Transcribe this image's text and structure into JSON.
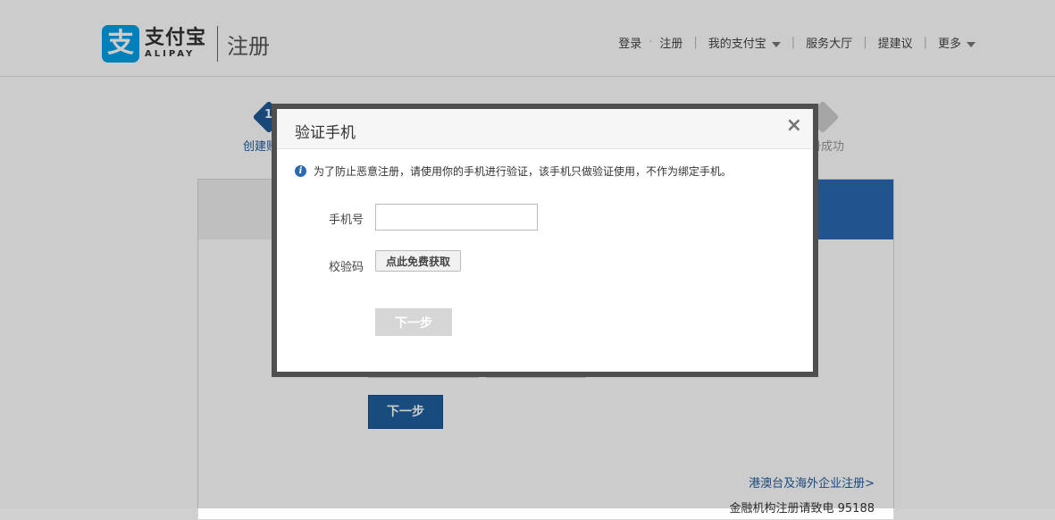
{
  "header": {
    "logo_mark": "支",
    "logo_cn": "支付宝",
    "logo_en": "ALIPAY",
    "page_name": "注册",
    "nav": {
      "login": "登录",
      "register": "注册",
      "my_alipay": "我的支付宝",
      "service_hall": "服务大厅",
      "suggest": "提建议",
      "more": "更多"
    }
  },
  "steps": {
    "step1_num": "1",
    "step1_label": "创建账",
    "step4_label": "册成功"
  },
  "background_form": {
    "next_label": "下一步",
    "hk_link": "港澳台及海外企业注册>",
    "fin_note": "金融机构注册请致电 95188"
  },
  "dialog": {
    "title": "验证手机",
    "close": "×",
    "info_icon": "i",
    "info_text": "为了防止恶意注册，请使用你的手机进行验证，该手机只做验证使用，不作为绑定手机。",
    "phone_label": "手机号",
    "phone_value": "",
    "code_label": "校验码",
    "get_code_label": "点此免费获取",
    "next_label": "下一步"
  },
  "colors": {
    "brand_blue": "#00a0e9",
    "primary": "#1f5e9e",
    "disabled": "#d6d6d6"
  }
}
